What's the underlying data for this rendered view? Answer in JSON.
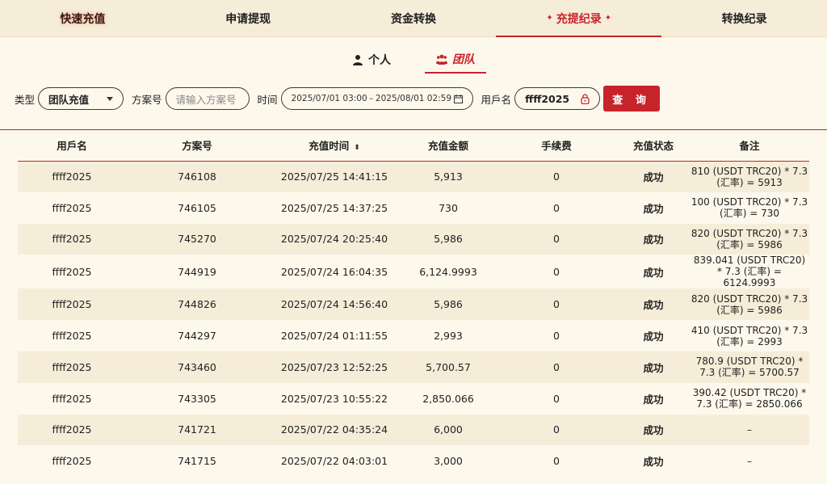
{
  "nav": [
    {
      "label": "快速充值"
    },
    {
      "label": "申请提现"
    },
    {
      "label": "资金转换"
    },
    {
      "label": "充提纪录"
    },
    {
      "label": "转换纪录"
    }
  ],
  "subtabs": {
    "personal": "个人",
    "team": "团队"
  },
  "filters": {
    "type_label": "类型",
    "type_value": "团队充值",
    "plan_label": "方案号",
    "plan_placeholder": "请输入方案号",
    "time_label": "时间",
    "date_start": "2025/07/01 03:00",
    "date_sep": "–",
    "date_end": "2025/08/01 02:59",
    "user_label": "用戶名",
    "user_value": "ffff2025",
    "query_label": "查 询"
  },
  "table": {
    "headers": [
      "用戶名",
      "方案号",
      "充值时间",
      "充值金额",
      "手续费",
      "充值状态",
      "备注"
    ],
    "rows": [
      [
        "ffff2025",
        "746108",
        "2025/07/25 14:41:15",
        "5,913",
        "0",
        "成功",
        "810 (USDT TRC20) * 7.3 (汇率) = 5913"
      ],
      [
        "ffff2025",
        "746105",
        "2025/07/25 14:37:25",
        "730",
        "0",
        "成功",
        "100 (USDT TRC20) * 7.3 (汇率) = 730"
      ],
      [
        "ffff2025",
        "745270",
        "2025/07/24 20:25:40",
        "5,986",
        "0",
        "成功",
        "820 (USDT TRC20) * 7.3 (汇率) = 5986"
      ],
      [
        "ffff2025",
        "744919",
        "2025/07/24 16:04:35",
        "6,124.9993",
        "0",
        "成功",
        "839.041 (USDT TRC20) * 7.3 (汇率) = 6124.9993"
      ],
      [
        "ffff2025",
        "744826",
        "2025/07/24 14:56:40",
        "5,986",
        "0",
        "成功",
        "820 (USDT TRC20) * 7.3 (汇率) = 5986"
      ],
      [
        "ffff2025",
        "744297",
        "2025/07/24 01:11:55",
        "2,993",
        "0",
        "成功",
        "410 (USDT TRC20) * 7.3 (汇率) = 2993"
      ],
      [
        "ffff2025",
        "743460",
        "2025/07/23 12:52:25",
        "5,700.57",
        "0",
        "成功",
        "780.9 (USDT TRC20) * 7.3 (汇率) = 5700.57"
      ],
      [
        "ffff2025",
        "743305",
        "2025/07/23 10:55:22",
        "2,850.066",
        "0",
        "成功",
        "390.42 (USDT TRC20) * 7.3 (汇率) = 2850.066"
      ],
      [
        "ffff2025",
        "741721",
        "2025/07/22 04:35:24",
        "6,000",
        "0",
        "成功",
        "–"
      ],
      [
        "ffff2025",
        "741715",
        "2025/07/22 04:03:01",
        "3,000",
        "0",
        "成功",
        "–"
      ]
    ]
  },
  "colors": {
    "accent": "#c7232a",
    "stripe": "#f6edd9",
    "bg": "#fdf8ec"
  }
}
